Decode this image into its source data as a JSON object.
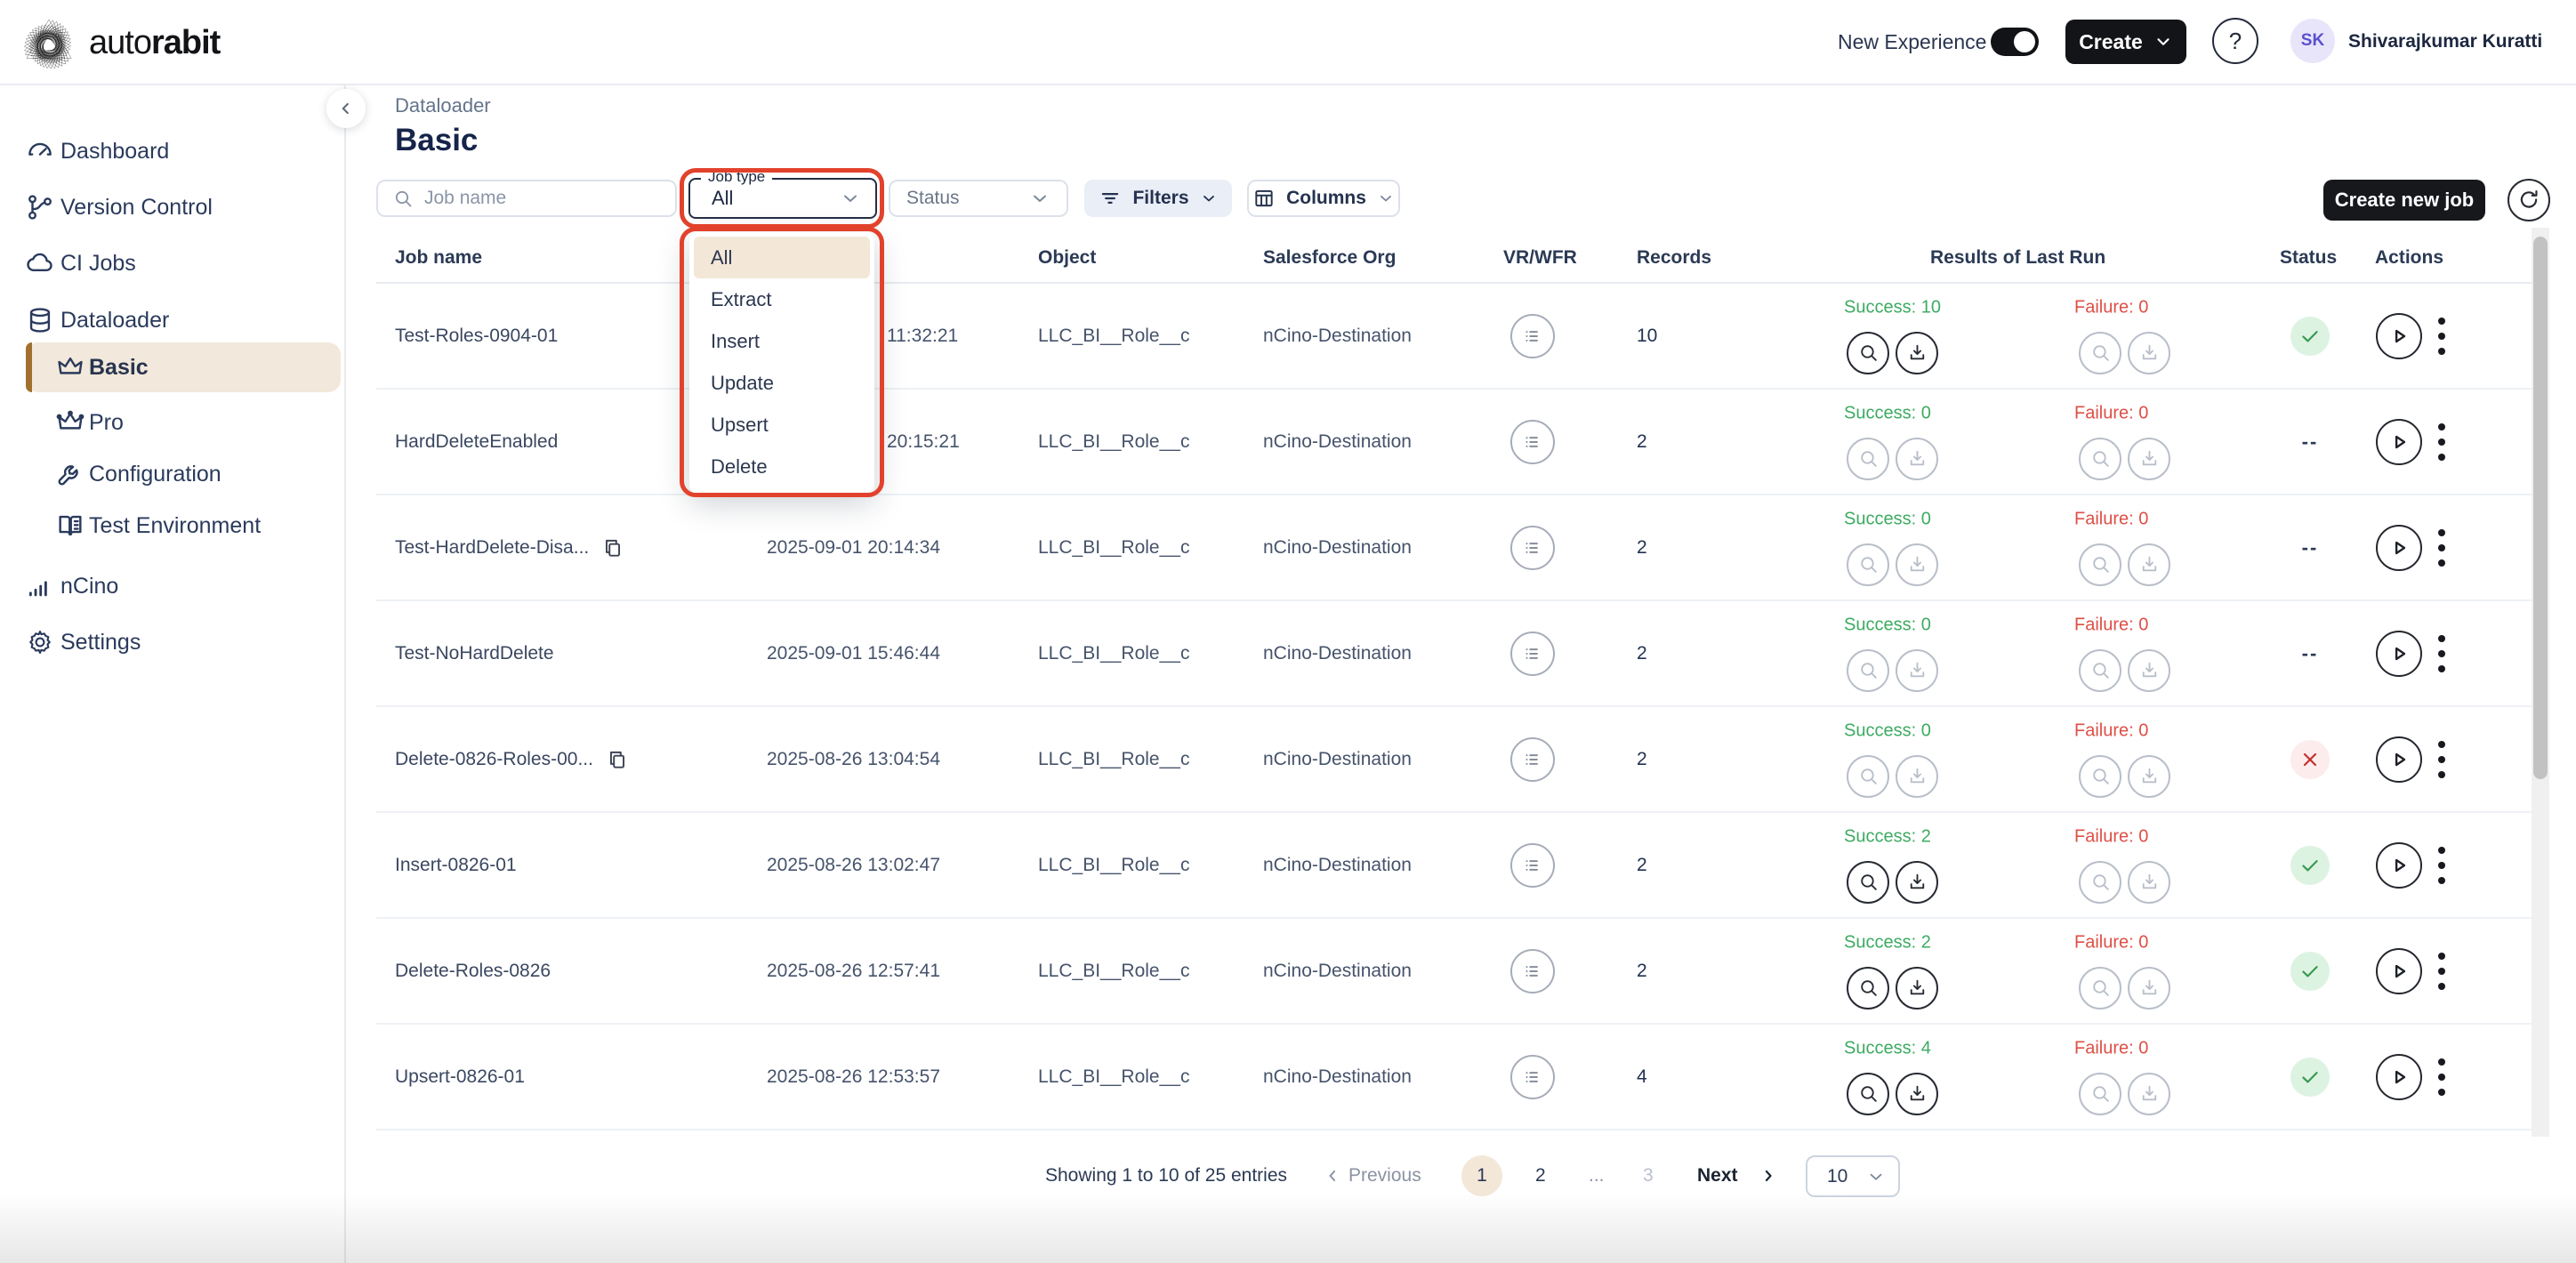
{
  "topbar": {
    "logo_light": "auto",
    "logo_bold": "rabit",
    "new_experience_label": "New Experience",
    "toggle_on": true,
    "create_label": "Create",
    "help_label": "?",
    "avatar_initials": "SK",
    "username": "Shivarajkumar Kuratti"
  },
  "sidebar": {
    "items": [
      {
        "label": "Dashboard",
        "icon": "dashboard-icon",
        "sub": false,
        "active": false
      },
      {
        "label": "Version Control",
        "icon": "version-control-icon",
        "sub": false,
        "active": false
      },
      {
        "label": "CI Jobs",
        "icon": "ci-jobs-icon",
        "sub": false,
        "active": false
      },
      {
        "label": "Dataloader",
        "icon": "dataloader-icon",
        "sub": false,
        "active": false
      },
      {
        "label": "Basic",
        "icon": "crown-icon",
        "sub": true,
        "active": true
      },
      {
        "label": "Pro",
        "icon": "crown-pro-icon",
        "sub": true,
        "active": false
      },
      {
        "label": "Configuration",
        "icon": "wrench-icon",
        "sub": true,
        "active": false
      },
      {
        "label": "Test Environment",
        "icon": "book-icon",
        "sub": true,
        "active": false
      },
      {
        "label": "nCino",
        "icon": "bars-icon",
        "sub": false,
        "active": false
      },
      {
        "label": "Settings",
        "icon": "gear-icon",
        "sub": false,
        "active": false
      }
    ]
  },
  "page": {
    "breadcrumb": "Dataloader",
    "title": "Basic"
  },
  "filters": {
    "search_placeholder": "Job name",
    "job_type": {
      "label": "Job type",
      "value": "All",
      "options": [
        "All",
        "Extract",
        "Insert",
        "Update",
        "Upsert",
        "Delete"
      ],
      "highlighted": "All"
    },
    "status_placeholder": "Status",
    "filters_label": "Filters",
    "columns_label": "Columns",
    "create_job_label": "Create new job"
  },
  "annotation": {
    "color": "#e2422c",
    "shape": "red rings around Job type select and its open menu"
  },
  "table": {
    "headers": [
      "Job name",
      "Object",
      "Salesforce Org",
      "VR/WFR",
      "Records",
      "Results of Last Run",
      "Status",
      "Actions"
    ],
    "rows": [
      {
        "name": "Test-Roles-0904-01",
        "copy": false,
        "created": "11:32:21",
        "created_partial": true,
        "object": "LLC_BI__Role__c",
        "org": "nCino-Destination",
        "records": "10",
        "success": "Success: 10",
        "failure": "Failure: 0",
        "success_enabled": true,
        "status": "ok"
      },
      {
        "name": "HardDeleteEnabled",
        "copy": false,
        "created": "20:15:21",
        "created_partial": true,
        "object": "LLC_BI__Role__c",
        "org": "nCino-Destination",
        "records": "2",
        "success": "Success: 0",
        "failure": "Failure: 0",
        "success_enabled": false,
        "status": "none"
      },
      {
        "name": "Test-HardDelete-Disa...",
        "copy": true,
        "created": "2025-09-01 20:14:34",
        "created_partial": false,
        "object": "LLC_BI__Role__c",
        "org": "nCino-Destination",
        "records": "2",
        "success": "Success: 0",
        "failure": "Failure: 0",
        "success_enabled": false,
        "status": "none"
      },
      {
        "name": "Test-NoHardDelete",
        "copy": false,
        "created": "2025-09-01 15:46:44",
        "created_partial": false,
        "object": "LLC_BI__Role__c",
        "org": "nCino-Destination",
        "records": "2",
        "success": "Success: 0",
        "failure": "Failure: 0",
        "success_enabled": false,
        "status": "none"
      },
      {
        "name": "Delete-0826-Roles-00...",
        "copy": true,
        "created": "2025-08-26 13:04:54",
        "created_partial": false,
        "object": "LLC_BI__Role__c",
        "org": "nCino-Destination",
        "records": "2",
        "success": "Success: 0",
        "failure": "Failure: 0",
        "success_enabled": false,
        "status": "fail"
      },
      {
        "name": "Insert-0826-01",
        "copy": false,
        "created": "2025-08-26 13:02:47",
        "created_partial": false,
        "object": "LLC_BI__Role__c",
        "org": "nCino-Destination",
        "records": "2",
        "success": "Success: 2",
        "failure": "Failure: 0",
        "success_enabled": true,
        "status": "ok"
      },
      {
        "name": "Delete-Roles-0826",
        "copy": false,
        "created": "2025-08-26 12:57:41",
        "created_partial": false,
        "object": "LLC_BI__Role__c",
        "org": "nCino-Destination",
        "records": "2",
        "success": "Success: 2",
        "failure": "Failure: 0",
        "success_enabled": true,
        "status": "ok"
      },
      {
        "name": "Upsert-0826-01",
        "copy": false,
        "created": "2025-08-26 12:53:57",
        "created_partial": false,
        "object": "LLC_BI__Role__c",
        "org": "nCino-Destination",
        "records": "4",
        "success": "Success: 4",
        "failure": "Failure: 0",
        "success_enabled": true,
        "status": "ok"
      }
    ],
    "status_none_text": "--"
  },
  "footer": {
    "showing": "Showing 1 to 10 of 25 entries",
    "previous_label": "Previous",
    "next_label": "Next",
    "pages": [
      {
        "label": "1",
        "state": "active"
      },
      {
        "label": "2",
        "state": "normal"
      },
      {
        "label": "...",
        "state": "muted"
      },
      {
        "label": "3",
        "state": "disabled"
      }
    ],
    "page_size": "10"
  }
}
